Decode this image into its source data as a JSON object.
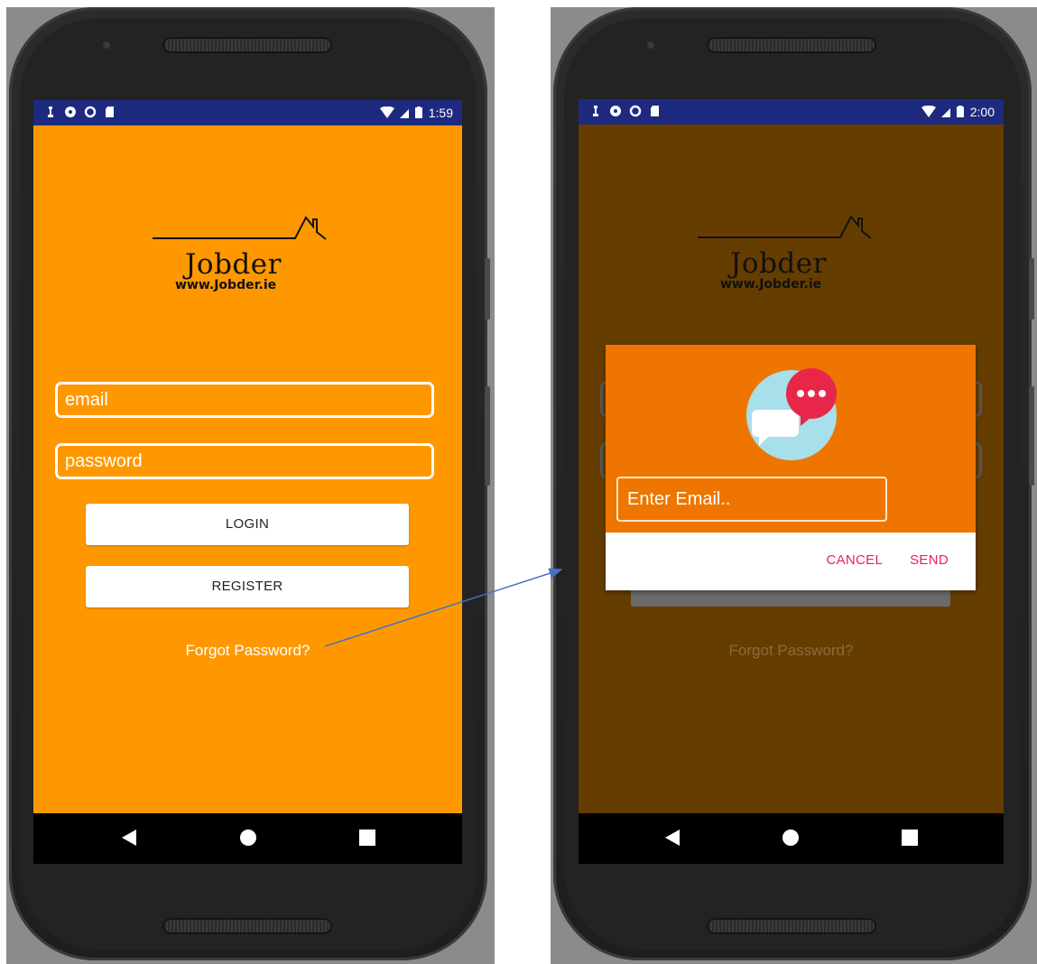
{
  "left_phone": {
    "status": {
      "time": "1:59"
    },
    "logo": {
      "name": "Jobder",
      "url": "www.Jobder.ie"
    },
    "email_placeholder": "email",
    "password_placeholder": "password",
    "login_label": "LOGIN",
    "register_label": "REGISTER",
    "forgot_label": "Forgot Password?"
  },
  "right_phone": {
    "status": {
      "time": "2:00"
    },
    "logo": {
      "name": "Jobder",
      "url": "www.Jobder.ie"
    },
    "background_forgot_label": "Forgot Password?",
    "dialog": {
      "email_placeholder": "Enter Email..",
      "cancel_label": "CANCEL",
      "send_label": "SEND"
    }
  },
  "colors": {
    "app_orange": "#ff9800",
    "dimmed_orange": "#663d00",
    "dialog_orange": "#ee7500",
    "status_bar": "#1e2a80",
    "accent_pink": "#e91e63"
  }
}
